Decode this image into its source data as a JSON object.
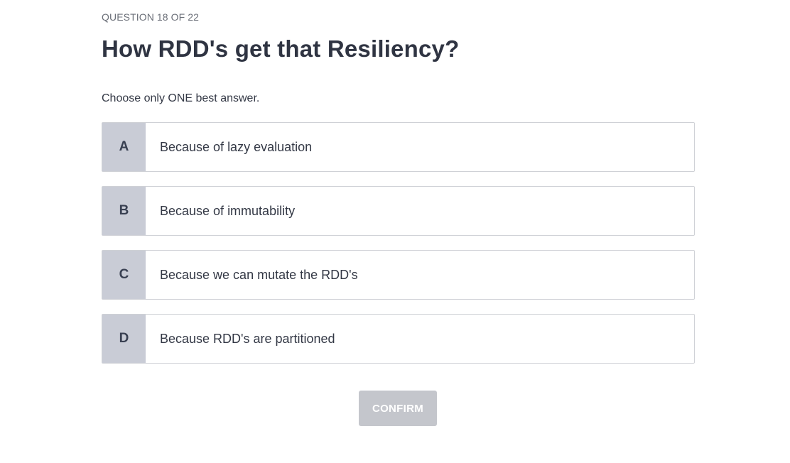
{
  "quiz": {
    "progress_label": "QUESTION 18 OF 22",
    "question": "How RDD's get that Resiliency?",
    "instruction": "Choose only ONE best answer.",
    "options": [
      {
        "letter": "A",
        "text": "Because of lazy evaluation"
      },
      {
        "letter": "B",
        "text": "Because of immutability"
      },
      {
        "letter": "C",
        "text": "Because we can mutate the RDD's"
      },
      {
        "letter": "D",
        "text": "Because RDD's are partitioned"
      }
    ],
    "confirm_label": "CONFIRM"
  },
  "colors": {
    "letter_bg": "#c9ccd6",
    "confirm_disabled_bg": "#c4c6cc",
    "text": "#333845"
  }
}
